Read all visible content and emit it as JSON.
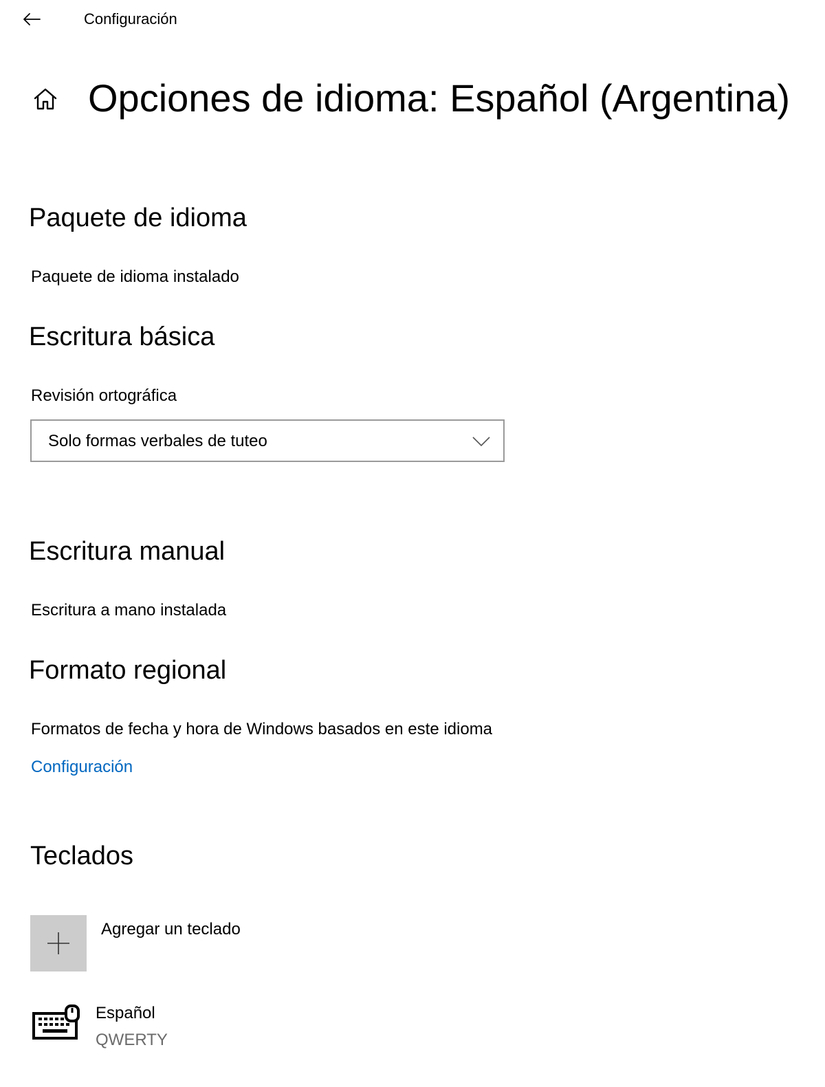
{
  "titlebar": {
    "back_icon": "back-arrow-icon",
    "title": "Configuración"
  },
  "header": {
    "home_icon": "home-icon",
    "title": "Opciones de idioma: Español (Argentina)"
  },
  "language_pack": {
    "heading": "Paquete de idioma",
    "status": "Paquete de idioma instalado"
  },
  "basic_typing": {
    "heading": "Escritura básica",
    "spellcheck_label": "Revisión ortográfica",
    "spellcheck_value": "Solo formas verbales de tuteo"
  },
  "handwriting": {
    "heading": "Escritura manual",
    "status": "Escritura a mano instalada"
  },
  "regional_format": {
    "heading": "Formato regional",
    "description": "Formatos de fecha y hora de Windows basados en este idioma",
    "link": "Configuración"
  },
  "keyboards": {
    "heading": "Teclados",
    "add_label": "Agregar un teclado",
    "items": [
      {
        "name": "Español",
        "layout": "QWERTY",
        "icon": "keyboard-icon"
      }
    ]
  },
  "colors": {
    "link": "#0067c0",
    "add_tile": "#cccccc",
    "dropdown_border": "#9a9a9a",
    "secondary_text": "#6b6b6b"
  }
}
